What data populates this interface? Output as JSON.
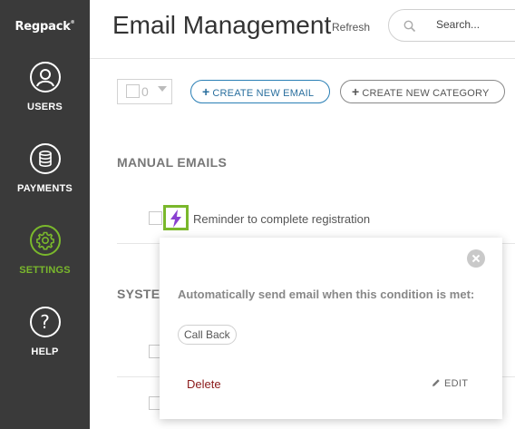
{
  "sidebar": {
    "logo": "Regpack",
    "items": [
      {
        "label": "USERS",
        "icon": "user-icon"
      },
      {
        "label": "PAYMENTS",
        "icon": "coins-icon"
      },
      {
        "label": "SETTINGS",
        "icon": "gear-icon",
        "active": true
      },
      {
        "label": "HELP",
        "icon": "question-icon"
      }
    ],
    "help_glyph": "?"
  },
  "header": {
    "title": "Email Management",
    "refresh": "Refresh",
    "search_placeholder": "Search..."
  },
  "toolbar": {
    "selected_count": "0",
    "create_email": "CREATE NEW EMAIL",
    "create_category": "CREATE NEW CATEGORY",
    "plus": "+"
  },
  "sections": {
    "manual_title": "MANUAL EMAILS",
    "system_title": "SYSTE",
    "manual_rows": [
      {
        "name": "Reminder to complete registration",
        "has_trigger": true
      }
    ]
  },
  "popover": {
    "heading": "Automatically send email when this condition is met:",
    "condition": "Call Back",
    "delete": "Delete",
    "edit": "EDIT"
  },
  "colors": {
    "sidebar_bg": "#3a3a3a",
    "accent_green": "#7ab82c",
    "bolt_purple": "#8a3fd1",
    "primary_blue": "#2a7fb5",
    "delete_red": "#8b1a1a"
  }
}
